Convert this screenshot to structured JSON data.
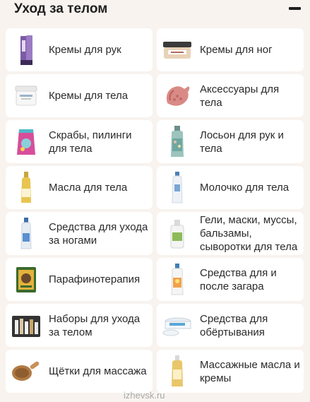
{
  "header": {
    "title": "Уход за телом"
  },
  "categories": [
    {
      "label": "Кремы для рук",
      "icon": "hand-cream-tube-icon",
      "color": "#7b5aa6"
    },
    {
      "label": "Кремы для ног",
      "icon": "foot-cream-jar-icon",
      "color": "#e9d2b8"
    },
    {
      "label": "Кремы для тела",
      "icon": "body-cream-jar-icon",
      "color": "#f2f2f2"
    },
    {
      "label": "Аксессуары для тела",
      "icon": "body-mitt-icon",
      "color": "#d98a86"
    },
    {
      "label": "Скрабы, пилинги для тела",
      "icon": "scrub-pouch-icon",
      "color": "#d84d9a"
    },
    {
      "label": "Лосьон для рук и тела",
      "icon": "lotion-bottle-icon",
      "color": "#6fa7a1"
    },
    {
      "label": "Масла для тела",
      "icon": "body-oil-bottle-icon",
      "color": "#e8c550"
    },
    {
      "label": "Молочко для тела",
      "icon": "body-milk-bottle-icon",
      "color": "#eef2f7"
    },
    {
      "label": "Средства для ухода за ногами",
      "icon": "foot-care-bottle-icon",
      "color": "#e6ecf3"
    },
    {
      "label": "Гели, маски, муссы, бальзамы, сыворотки для тела",
      "icon": "gel-jar-icon",
      "color": "#8dbb5a"
    },
    {
      "label": "Парафинотерапия",
      "icon": "paraffin-box-icon",
      "color": "#3b6a2d"
    },
    {
      "label": "Средства для и после загара",
      "icon": "sun-care-bottle-icon",
      "color": "#f0a24b"
    },
    {
      "label": "Наборы для ухода за телом",
      "icon": "gift-set-icon",
      "color": "#333333"
    },
    {
      "label": "Средства для обёртывания",
      "icon": "wrap-jars-icon",
      "color": "#5aa7d6"
    },
    {
      "label": "Щётки для массажа",
      "icon": "massage-brush-icon",
      "color": "#b07a43"
    },
    {
      "label": "Массажные масла и кремы",
      "icon": "massage-oil-bottle-icon",
      "color": "#e9c66a"
    }
  ],
  "watermark": "izhevsk.ru"
}
